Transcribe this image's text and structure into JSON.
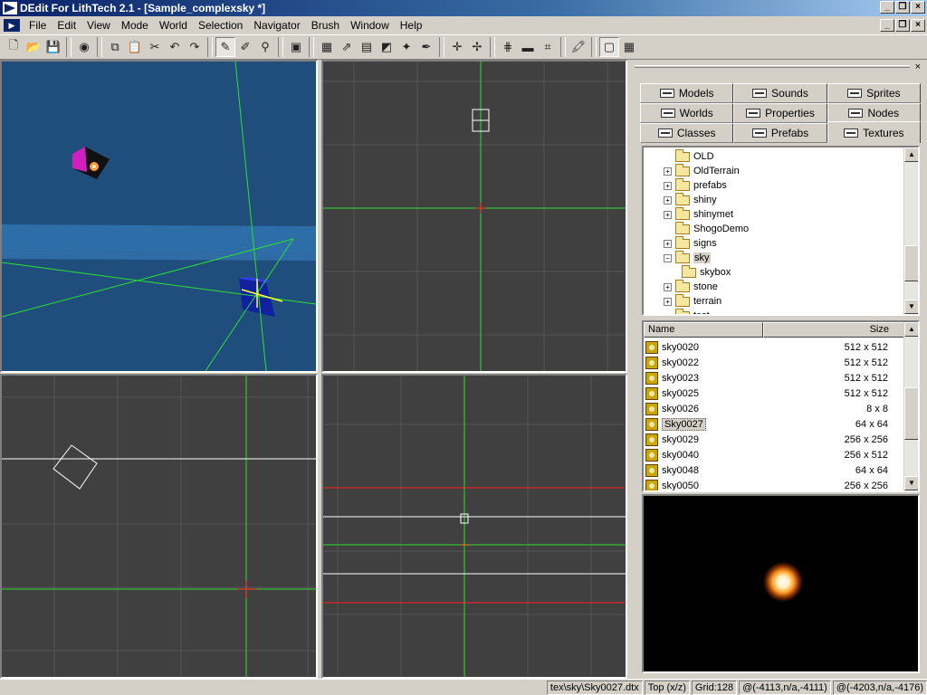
{
  "window": {
    "title": "DEdit For LithTech 2.1 - [Sample_complexsky *]"
  },
  "menu": [
    "File",
    "Edit",
    "View",
    "Mode",
    "World",
    "Selection",
    "Navigator",
    "Brush",
    "Window",
    "Help"
  ],
  "tabs": {
    "row1": [
      "Models",
      "Sounds",
      "Sprites"
    ],
    "row2": [
      "Worlds",
      "Properties",
      "Nodes"
    ],
    "row3": [
      "Classes",
      "Prefabs",
      "Textures"
    ],
    "active": "Textures"
  },
  "tree": [
    {
      "label": "OLD",
      "expander": ""
    },
    {
      "label": "OldTerrain",
      "expander": "+"
    },
    {
      "label": "prefabs",
      "expander": "+"
    },
    {
      "label": "shiny",
      "expander": "+"
    },
    {
      "label": "shinymet",
      "expander": "+"
    },
    {
      "label": "ShogoDemo",
      "expander": ""
    },
    {
      "label": "signs",
      "expander": "+"
    },
    {
      "label": "sky",
      "expander": "-",
      "selected": true
    },
    {
      "label": "skybox",
      "expander": "",
      "child": true
    },
    {
      "label": "stone",
      "expander": "+"
    },
    {
      "label": "terrain",
      "expander": "+"
    },
    {
      "label": "test",
      "expander": ""
    }
  ],
  "filelist": {
    "col_name": "Name",
    "col_size": "Size",
    "rows": [
      {
        "name": "sky0020",
        "size": "512 x 512"
      },
      {
        "name": "sky0022",
        "size": "512 x 512"
      },
      {
        "name": "sky0023",
        "size": "512 x 512"
      },
      {
        "name": "sky0025",
        "size": "512 x 512"
      },
      {
        "name": "sky0026",
        "size": "8 x 8"
      },
      {
        "name": "Sky0027",
        "size": "64 x 64",
        "selected": true
      },
      {
        "name": "sky0029",
        "size": "256 x 256"
      },
      {
        "name": "sky0040",
        "size": "256 x 512"
      },
      {
        "name": "sky0048",
        "size": "64 x 64"
      },
      {
        "name": "sky0050",
        "size": "256 x 256"
      }
    ]
  },
  "status": {
    "texture": "tex\\sky\\Sky0027.dtx",
    "view": "Top (x/z)",
    "grid": "Grid:128",
    "coord1": "@(-4113,n/a,-4111)",
    "coord2": "@(-4203,n/a,-4176)"
  }
}
